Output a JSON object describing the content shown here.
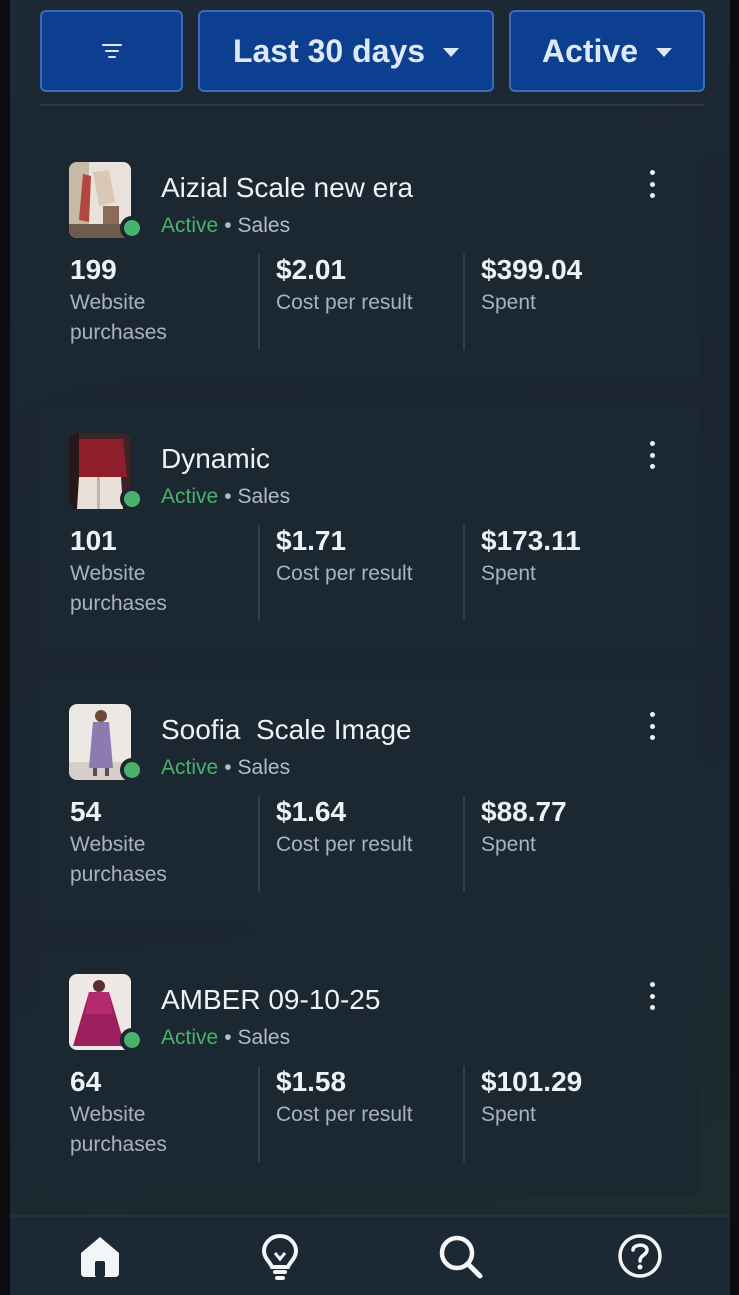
{
  "filters": {
    "filter_icon": "filter-icon",
    "date_range": "Last 30 days",
    "status": "Active"
  },
  "campaigns": [
    {
      "name": "Aizial Scale new era",
      "status": "Active",
      "objective": "Sales",
      "results": "199",
      "results_label": "Website purchases",
      "cost_per_result": "$2.01",
      "cost_label": "Cost per result",
      "spent": "$399.04",
      "spent_label": "Spent"
    },
    {
      "name": "Dynamic",
      "status": "Active",
      "objective": "Sales",
      "results": "101",
      "results_label": "Website purchases",
      "cost_per_result": "$1.71",
      "cost_label": "Cost per result",
      "spent": "$173.11",
      "spent_label": "Spent"
    },
    {
      "name": "Soofia  Scale Image",
      "status": "Active",
      "objective": "Sales",
      "results": "54",
      "results_label": "Website purchases",
      "cost_per_result": "$1.64",
      "cost_label": "Cost per result",
      "spent": "$88.77",
      "spent_label": "Spent"
    },
    {
      "name": "AMBER 09-10-25",
      "status": "Active",
      "objective": "Sales",
      "results": "64",
      "results_label": "Website purchases",
      "cost_per_result": "$1.58",
      "cost_label": "Cost per result",
      "spent": "$101.29",
      "spent_label": "Spent"
    }
  ],
  "separator": "•",
  "nav": [
    "home-icon",
    "lightbulb-icon",
    "search-icon",
    "help-icon"
  ],
  "colors": {
    "background": "#1a2530",
    "card": "#1b2731",
    "button": "#0c3f8f",
    "active_green": "#4bb26d",
    "text": "#eef2f6",
    "muted": "#aab3bd"
  }
}
